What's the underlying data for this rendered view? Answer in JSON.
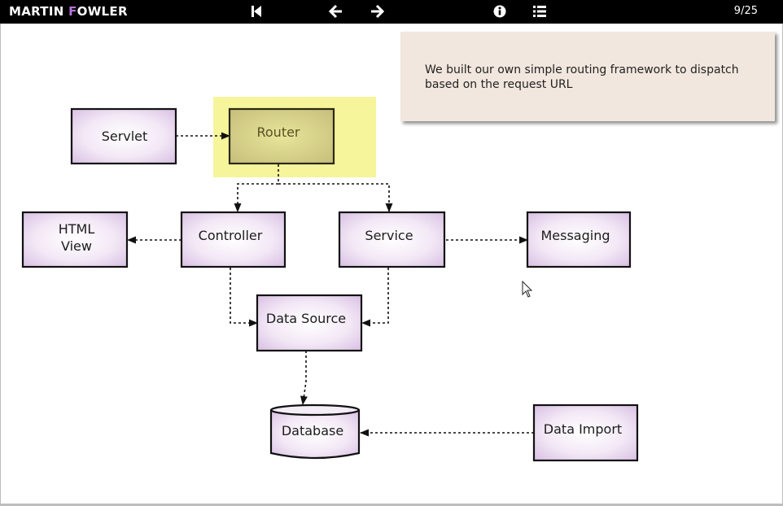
{
  "header": {
    "logo_first": "MARTIN ",
    "logo_accent": "F",
    "logo_rest": "OWLER",
    "nav": {
      "first_icon": "skip-to-first-icon",
      "prev_icon": "arrow-left-icon",
      "next_icon": "arrow-right-icon",
      "info_icon": "info-icon",
      "list_icon": "list-icon"
    },
    "page_counter": "9/25"
  },
  "note": {
    "text": "We built our own simple routing framework to dispatch based on the request URL"
  },
  "diagram": {
    "highlight_color": "#f6f59b",
    "node_fill": "#eadaf0",
    "nodes": {
      "servlet": "Servlet",
      "router": "Router",
      "html_view_line1": "HTML",
      "html_view_line2": "View",
      "controller": "Controller",
      "service": "Service",
      "messaging": "Messaging",
      "data_source": "Data Source",
      "database": "Database",
      "data_import": "Data Import"
    }
  },
  "colors": {
    "topbar": "#000000",
    "logo_accent": "#b675d9",
    "note_background": "#f2e7de"
  }
}
